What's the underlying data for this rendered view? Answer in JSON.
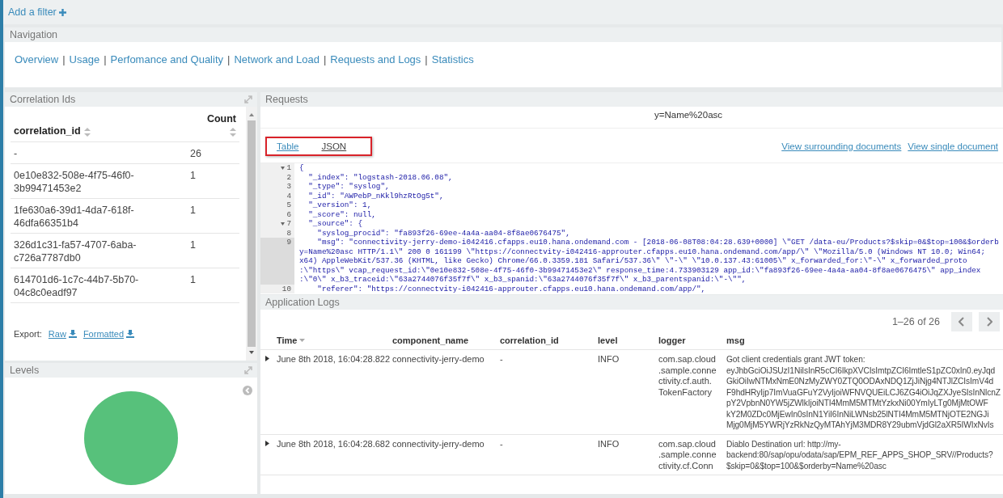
{
  "filter_bar": {
    "add_filter": "Add a filter"
  },
  "navigation": {
    "title": "Navigation",
    "items": [
      {
        "kind": "link",
        "text": "Overview"
      },
      {
        "kind": "separator",
        "text": "|"
      },
      {
        "kind": "link",
        "text": "Usage"
      },
      {
        "kind": "separator",
        "text": "|"
      },
      {
        "kind": "link",
        "text": "Perfomance and Quality"
      },
      {
        "kind": "separator",
        "text": "|"
      },
      {
        "kind": "link",
        "text": "Network and Load"
      },
      {
        "kind": "separator",
        "text": "|"
      },
      {
        "kind": "link",
        "text": "Requests and Logs"
      },
      {
        "kind": "separator",
        "text": "|"
      },
      {
        "kind": "link",
        "text": "Statistics"
      }
    ]
  },
  "correlation_ids": {
    "title": "Correlation Ids",
    "columns": [
      "correlation_id",
      "Count"
    ],
    "rows": [
      {
        "id": [
          "-"
        ],
        "count": "26"
      },
      {
        "id": [
          "0e10e832-508e-4f75-46f0-",
          "3b99471453e2"
        ],
        "count": "1"
      },
      {
        "id": [
          "1fe630a6-39d1-4da7-618f-",
          "46dfa66351b4"
        ],
        "count": "1"
      },
      {
        "id": [
          "326d1c31-fa57-4707-6aba-",
          "c726a7787db0"
        ],
        "count": "1"
      },
      {
        "id": [
          "614701d6-1c7c-44b7-5b70-",
          "04c8c0eadf97"
        ],
        "count": "1"
      }
    ],
    "export_label": "Export:",
    "export_links": [
      "Raw",
      "Formatted"
    ]
  },
  "levels": {
    "title": "Levels"
  },
  "requests": {
    "title": "Requests",
    "url_tail": "y=Name%20asc",
    "tabs": [
      {
        "label": "Table",
        "selected": false
      },
      {
        "label": "JSON",
        "selected": true
      }
    ],
    "links": [
      "View surrounding documents",
      "View single document"
    ],
    "code_lines": [
      {
        "num": "1",
        "fold": true,
        "active": false,
        "text": [
          "{"
        ]
      },
      {
        "num": "2",
        "fold": false,
        "active": false,
        "text": [
          "  \"_index\": \"logstash-2018.06.08\","
        ]
      },
      {
        "num": "3",
        "fold": false,
        "active": false,
        "text": [
          "  \"_type\": \"syslog\","
        ]
      },
      {
        "num": "4",
        "fold": false,
        "active": false,
        "text": [
          "  \"_id\": \"AWPebP_nKkl9hzRtOg5t\","
        ]
      },
      {
        "num": "5",
        "fold": false,
        "active": false,
        "text": [
          "  \"_version\": 1,"
        ]
      },
      {
        "num": "6",
        "fold": false,
        "active": false,
        "text": [
          "  \"_score\": null,"
        ]
      },
      {
        "num": "7",
        "fold": true,
        "active": false,
        "text": [
          "  \"_source\": {"
        ]
      },
      {
        "num": "8",
        "fold": false,
        "active": false,
        "text": [
          "    \"syslog_procid\": \"fa893f26-69ee-4a4a-aa04-8f8ae0676475\","
        ]
      },
      {
        "num": "9",
        "fold": false,
        "active": true,
        "text": [
          "    \"msg\": \"connectivity-jerry-demo-i042416.cfapps.eu10.hana.ondemand.com - [2018-06-08T08:04:28.639+0000] \\\"GET /data-eu/Products?$skip=0&$top=100&$orderb",
          "y=Name%20asc HTTP/1.1\\\" 200 0 161199 \\\"https://connectvity-i042416-approuter.cfapps.eu10.hana.ondemand.com/app/\\\" \\\"Mozilla/5.0 (Windows NT 10.0; Win64;",
          "x64) AppleWebKit/537.36 (KHTML, like Gecko) Chrome/66.0.3359.181 Safari/537.36\\\" \\\"-\\\" \\\"10.0.137.43:61005\\\" x_forwarded_for:\\\"-\\\" x_forwarded_proto",
          ":\\\"https\\\" vcap_request_id:\\\"0e10e832-508e-4f75-46f0-3b99471453e2\\\" response_time:4.733903129 app_id:\\\"fa893f26-69ee-4a4a-aa04-8f8ae0676475\\\" app_index",
          ":\\\"0\\\" x_b3_traceid:\\\"63a2744076f35f7f\\\" x_b3_spanid:\\\"63a2744076f35f7f\\\" x_b3_parentspanid:\\\"-\\\"\","
        ]
      },
      {
        "num": "10",
        "fold": false,
        "active": false,
        "text": [
          "    \"referer\": \"https://connectvity-i042416-approuter.cfapps.eu10.hana.ondemand.com/app/\","
        ]
      }
    ]
  },
  "application_logs": {
    "title": "Application Logs",
    "pager": "1–26 of 26",
    "columns": [
      "Time",
      "component_name",
      "correlation_id",
      "level",
      "logger",
      "msg"
    ],
    "rows": [
      {
        "time": "June 8th 2018, 16:04:28.822",
        "component": "connectivity-jerry-demo",
        "correlation_id": "-",
        "level": "INFO",
        "logger": [
          "com.sap.cloud",
          ".sample.conne",
          "ctivity.cf.auth.",
          "TokenFactory"
        ],
        "msg": [
          "Got client credentials grant JWT token:",
          "eyJhbGciOiJSUzI1NiIsInR5cCI6IkpXVCIsImtpZCI6ImtleS1pZC0xIn0.eyJqd",
          "GkiOiIwNTMxNmE0NzMyZWY0ZTQ0ODAxNDQ1ZjJiNjg4NTJlZCIsImV4d",
          "F9hdHRyIjp7ImVuaGFuY2VyIjoiWFNVQUEiLCJ6ZG4iOiJqZXJyeSIsInNlcnZ",
          "pY2VpbnN0YW5jZWlkIjoiNTI4MmM5MTMtYzkxNi00YmIyLTg0MjMtOWF",
          "kY2M0ZDc0MjEwIn0sInN1YiI6InNiLWNsb25lNTI4MmM5MTNjOTE2NGJi",
          "Mjg0MjM5YWRjYzRkNzQyMTAhYjM3MDR8Y29ubmVjdGl2aXR5IWIxNvIs"
        ]
      },
      {
        "time": "June 8th 2018, 16:04:28.682",
        "component": "connectivity-jerry-demo",
        "correlation_id": "-",
        "level": "INFO",
        "logger": [
          "com.sap.cloud",
          ".sample.conne",
          "ctivity.cf.Conn"
        ],
        "msg": [
          "Diablo Destination url: http://my-",
          "backend:80/sap/opu/odata/sap/EPM_REF_APPS_SHOP_SRV//Products?",
          "$skip=0&$top=100&$orderby=Name%20asc"
        ]
      }
    ]
  }
}
